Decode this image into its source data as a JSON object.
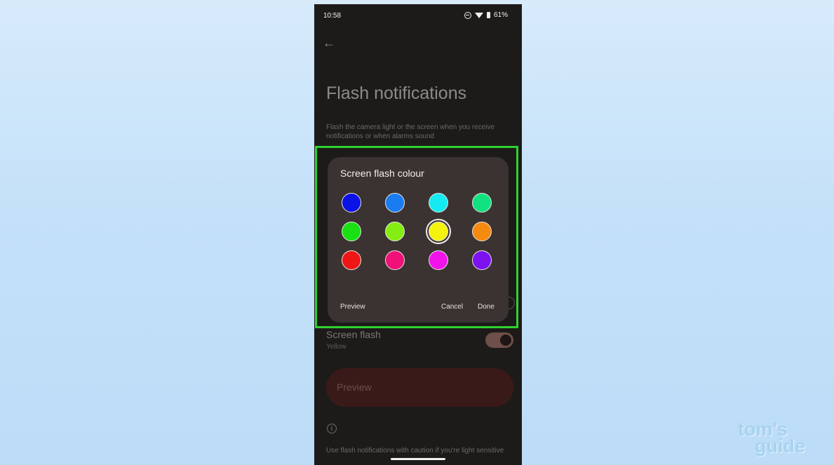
{
  "status": {
    "time": "10:58",
    "battery": "61%"
  },
  "page": {
    "title": "Flash notifications",
    "description": "Flash the camera light or the screen when you receive notifications or when alarms sound",
    "screen_flash": {
      "label": "Screen flash",
      "value": "Yellow",
      "enabled": true
    },
    "preview_button": "Preview",
    "caution": "Use flash notifications with caution if you're light sensitive"
  },
  "dialog": {
    "title": "Screen flash colour",
    "selected": "yellow",
    "colors": [
      {
        "name": "blue",
        "hex": "#0a12e6"
      },
      {
        "name": "azure",
        "hex": "#1a7cf0"
      },
      {
        "name": "cyan",
        "hex": "#14eaf0"
      },
      {
        "name": "spring-green",
        "hex": "#12e17f"
      },
      {
        "name": "green",
        "hex": "#18e012"
      },
      {
        "name": "chartreuse",
        "hex": "#84ee12"
      },
      {
        "name": "yellow",
        "hex": "#f5f20d"
      },
      {
        "name": "orange",
        "hex": "#f58a10"
      },
      {
        "name": "red",
        "hex": "#f01616"
      },
      {
        "name": "rose",
        "hex": "#f01077"
      },
      {
        "name": "magenta",
        "hex": "#f014ea"
      },
      {
        "name": "violet",
        "hex": "#7c12f0"
      }
    ],
    "buttons": {
      "preview": "Preview",
      "cancel": "Cancel",
      "done": "Done"
    }
  },
  "watermark": {
    "line1": "tom's",
    "line2": "guide"
  }
}
